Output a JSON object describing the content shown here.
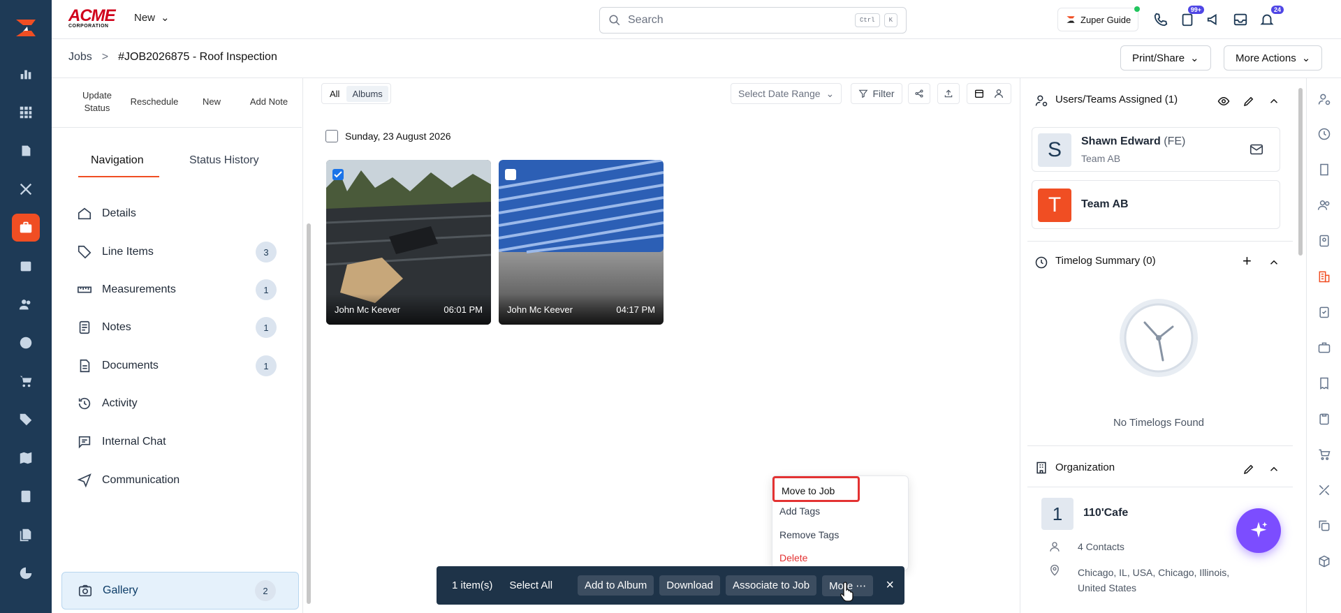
{
  "brand": {
    "name": "ACME",
    "sub": "CORPORATION"
  },
  "topbar": {
    "new_label": "New",
    "search_placeholder": "Search",
    "kbd_ctrl": "Ctrl",
    "kbd_k": "K",
    "guide_label": "Zuper Guide",
    "tasks_badge": "99+",
    "notif_badge": "24"
  },
  "breadcrumb": {
    "root": "Jobs",
    "sep": ">",
    "current": "#JOB2026875 - Roof Inspection"
  },
  "header_actions": {
    "print": "Print/Share",
    "more": "More Actions"
  },
  "quick_actions": [
    "Update Status",
    "Reschedule",
    "New",
    "Add Note"
  ],
  "nav_tabs": {
    "navigation": "Navigation",
    "history": "Status History"
  },
  "nav_items": [
    {
      "label": "Details",
      "count": ""
    },
    {
      "label": "Line Items",
      "count": "3"
    },
    {
      "label": "Measurements",
      "count": "1"
    },
    {
      "label": "Notes",
      "count": "1"
    },
    {
      "label": "Documents",
      "count": "1"
    },
    {
      "label": "Activity",
      "count": ""
    },
    {
      "label": "Internal Chat",
      "count": ""
    },
    {
      "label": "Communication",
      "count": ""
    },
    {
      "label": "Gallery",
      "count": "2"
    }
  ],
  "gallery": {
    "tab_all": "All",
    "tab_albums": "Albums",
    "date_range": "Select Date Range",
    "filter": "Filter",
    "date_heading": "Sunday, 23 August 2026",
    "photos": [
      {
        "author": "John Mc Keever",
        "time": "06:01 PM",
        "checked": true
      },
      {
        "author": "John Mc Keever",
        "time": "04:17 PM",
        "checked": false
      }
    ]
  },
  "action_bar": {
    "count": "1 item(s)",
    "select_all": "Select All",
    "add_album": "Add to Album",
    "download": "Download",
    "associate": "Associate to Job",
    "more": "More"
  },
  "more_menu": [
    "Move to Job",
    "Add Tags",
    "Remove Tags",
    "Delete"
  ],
  "right": {
    "assigned_title": "Users/Teams Assigned (1)",
    "user_initial": "S",
    "user_name": "Shawn Edward",
    "user_role": "(FE)",
    "user_team": "Team AB",
    "team_initial": "T",
    "team_name": "Team AB",
    "timelog_title": "Timelog Summary (0)",
    "timelog_empty": "No Timelogs Found",
    "org_title": "Organization",
    "org_initial": "1",
    "org_name": "110'Cafe",
    "contacts": "4 Contacts",
    "address_line1": "Chicago, IL, USA, Chicago, Illinois,",
    "address_line2": "United States"
  },
  "colors": {
    "rail": "#1e3a56",
    "accent": "#f04e23",
    "danger": "#e33232",
    "fab": "#7c4dff"
  }
}
